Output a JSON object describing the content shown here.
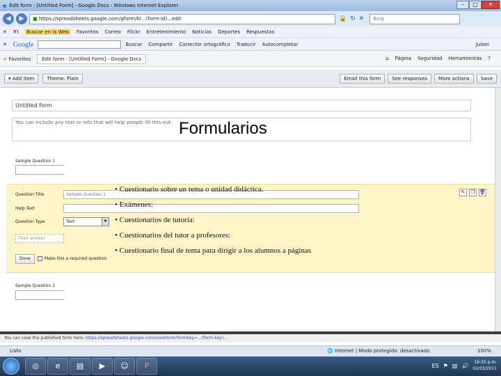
{
  "window": {
    "title": "Edit form - [Untitled Form] - Google Docs - Windows Internet Explorer"
  },
  "address_bar": {
    "url": "https://spreadsheets.google.com/gform/bl...(form-id)...edit",
    "search_placeholder": "Bing"
  },
  "toolbar1": {
    "items": [
      "Buscar en la Web",
      "Favoritos",
      "Correo",
      "Flickr",
      "Entretenimiento",
      "Noticias",
      "Deportes",
      "Respuestas"
    ]
  },
  "toolbar2": {
    "brand": "Google",
    "items": [
      "Buscar",
      "Compartir",
      "Corrector ortográfico",
      "Traducir",
      "Autocompletar"
    ],
    "user": "Julien"
  },
  "command_bar": {
    "favorites": "Favoritos",
    "tab_title": "Edit form - [Untitled Form] - Google Docs",
    "menus": [
      "Página",
      "Seguridad",
      "Herramientas"
    ]
  },
  "docs_toolbar": {
    "add_item": "Add item",
    "theme": "Theme: Plain",
    "email_form": "Email this form",
    "see_responses": "See responses",
    "more_actions": "More actions",
    "save": "Save"
  },
  "form": {
    "title": "Untitled form",
    "description": "You can include any text or info that will help people fill this out.",
    "q1_title": "Sample Question 1",
    "edit": {
      "question_title_label": "Question Title",
      "question_title_value": "Sample Question 1",
      "help_text_label": "Help Text",
      "question_type_label": "Question Type",
      "question_type_value": "Text",
      "answer_placeholder": "Their answer",
      "done": "Done",
      "required_label": "Make this a required question"
    },
    "q2_title": "Sample Question 2"
  },
  "slide": {
    "title": "Formularios",
    "bullets": [
      "Cuestionario sobre un tema o unidad didáctica.",
      "Exámenes:",
      "Cuestionarios de tutoría:",
      "Cuestionarios del tutor a profesores:",
      "Cuestionario final de tema para dirigir a los alumnos a páginas"
    ]
  },
  "bottom_bar": {
    "text": "You can view the published form here:",
    "link": "https://spreadsheets.google.com/viewform?formkey=...(form-key)..."
  },
  "statusbar": {
    "left": "Listo",
    "zone": "Internet | Modo protegido: desactivado",
    "zoom": "100%"
  },
  "taskbar": {
    "lang": "ES",
    "time": "19:35 p.m.",
    "date": "02/03/2011"
  }
}
